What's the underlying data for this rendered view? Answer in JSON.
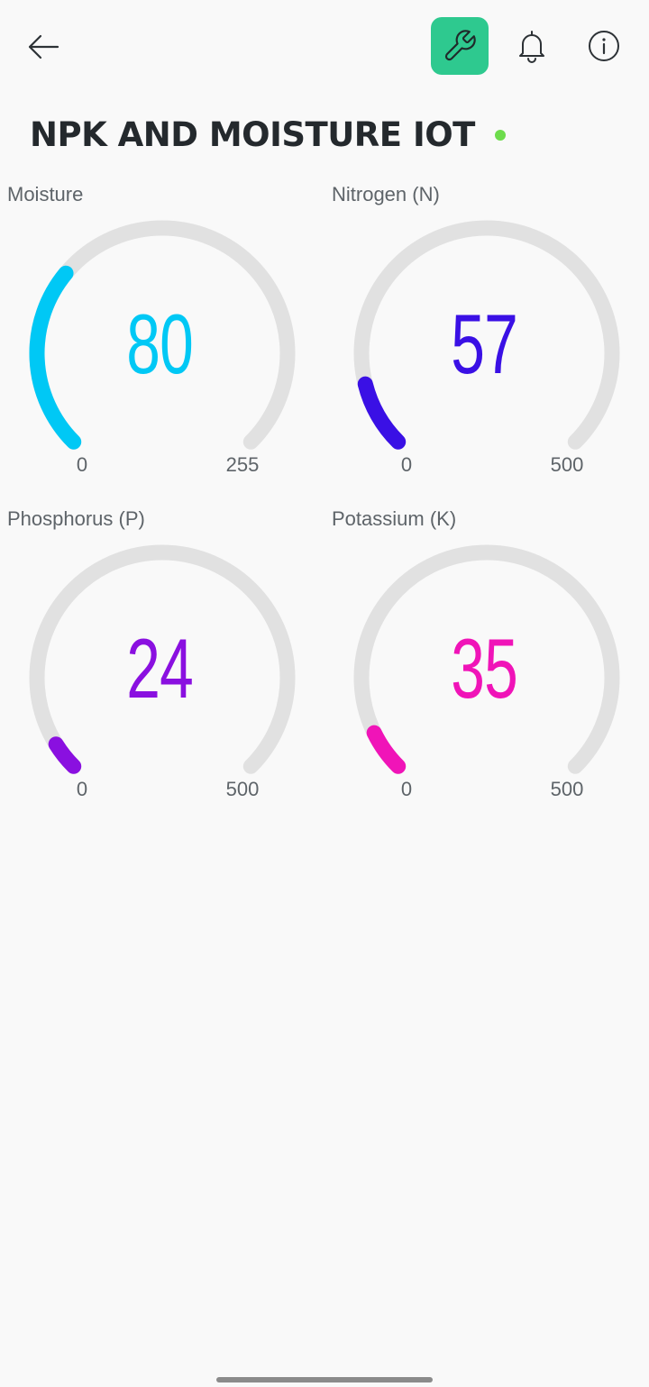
{
  "header": {
    "back_icon": "arrow-left-icon",
    "settings_icon": "wrench-icon",
    "notifications_icon": "bell-icon",
    "info_icon": "info-icon",
    "accent_color": "#2ec98f",
    "title": "NPK AND MOISTURE IOT",
    "online_status_color": "#6ddc4c"
  },
  "gauges": [
    {
      "label": "Moisture",
      "value": "80",
      "min": "0",
      "max": "255",
      "fraction": 0.3137,
      "color": "#00c8f5"
    },
    {
      "label": "Nitrogen (N)",
      "value": "57",
      "min": "0",
      "max": "500",
      "fraction": 0.114,
      "color": "#3a10e5"
    },
    {
      "label": "Phosphorus (P)",
      "value": "24",
      "min": "0",
      "max": "500",
      "fraction": 0.048,
      "color": "#8a10e0"
    },
    {
      "label": "Potassium (K)",
      "value": "35",
      "min": "0",
      "max": "500",
      "fraction": 0.07,
      "color": "#f014b8"
    }
  ]
}
